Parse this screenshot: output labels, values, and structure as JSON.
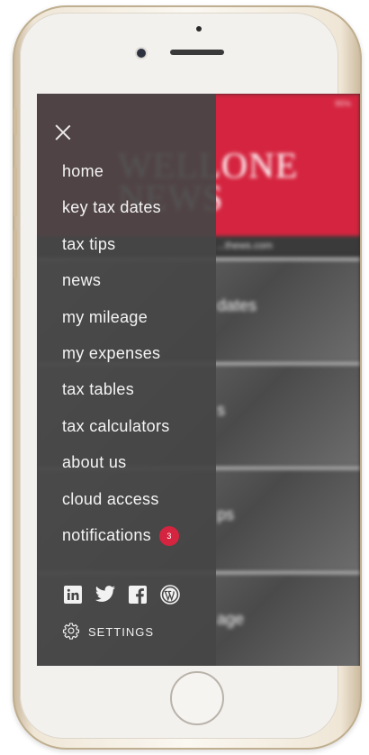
{
  "drawer": {
    "menu": [
      {
        "id": "home",
        "label": "home"
      },
      {
        "id": "key-tax-dates",
        "label": "key tax dates"
      },
      {
        "id": "tax-tips",
        "label": "tax tips"
      },
      {
        "id": "news",
        "label": "news"
      },
      {
        "id": "my-mileage",
        "label": "my mileage"
      },
      {
        "id": "my-expenses",
        "label": "my expenses"
      },
      {
        "id": "tax-tables",
        "label": "tax tables"
      },
      {
        "id": "tax-calculators",
        "label": "tax calculators"
      },
      {
        "id": "about-us",
        "label": "about us"
      },
      {
        "id": "cloud-access",
        "label": "cloud access"
      },
      {
        "id": "notifications",
        "label": "notifications",
        "badge": "3"
      }
    ],
    "social": [
      "linkedin-icon",
      "twitter-icon",
      "facebook-icon",
      "wordpress-icon"
    ],
    "settings_label": "SETTINGS"
  },
  "background_app": {
    "status": "95%",
    "title_line1": "WELLONE",
    "title_line2": "NEWS",
    "url": "...thews.com",
    "cards": [
      "dates",
      "s",
      "ps",
      "age"
    ]
  },
  "colors": {
    "accent": "#d5243f",
    "drawer": "#464646",
    "frame": "#efe6d6"
  }
}
